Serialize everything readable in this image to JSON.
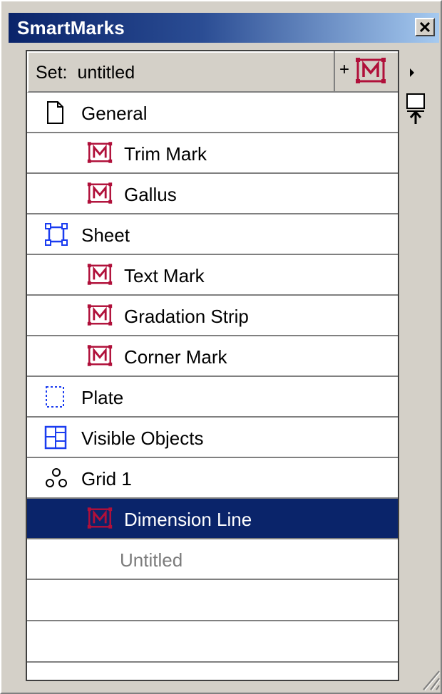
{
  "window": {
    "title": "SmartMarks"
  },
  "set": {
    "prefix": "Set:",
    "name": "untitled",
    "add_plus": "+"
  },
  "items": [
    {
      "label": "General",
      "level": 0,
      "icon": "page-icon"
    },
    {
      "label": "Trim Mark",
      "level": 1,
      "icon": "smartmark-icon"
    },
    {
      "label": "Gallus",
      "level": 1,
      "icon": "smartmark-icon"
    },
    {
      "label": "Sheet",
      "level": 0,
      "icon": "sheet-icon"
    },
    {
      "label": "Text Mark",
      "level": 1,
      "icon": "smartmark-icon"
    },
    {
      "label": "Gradation Strip",
      "level": 1,
      "icon": "smartmark-icon"
    },
    {
      "label": "Corner Mark",
      "level": 1,
      "icon": "smartmark-icon"
    },
    {
      "label": "Plate",
      "level": 0,
      "icon": "plate-icon"
    },
    {
      "label": "Visible Objects",
      "level": 0,
      "icon": "visible-objects-icon"
    },
    {
      "label": "Grid 1",
      "level": 0,
      "icon": "grid-icon"
    },
    {
      "label": "Dimension Line",
      "level": 1,
      "icon": "smartmark-icon",
      "selected": true
    },
    {
      "label": "Untitled",
      "level": 1,
      "muted": true
    }
  ],
  "colors": {
    "title_bar_start": "#0a246a",
    "title_bar_end": "#a6caf0",
    "selection": "#0a246a",
    "smartmark_icon": "#b0103a",
    "object_icon": "#1a3cf0"
  }
}
